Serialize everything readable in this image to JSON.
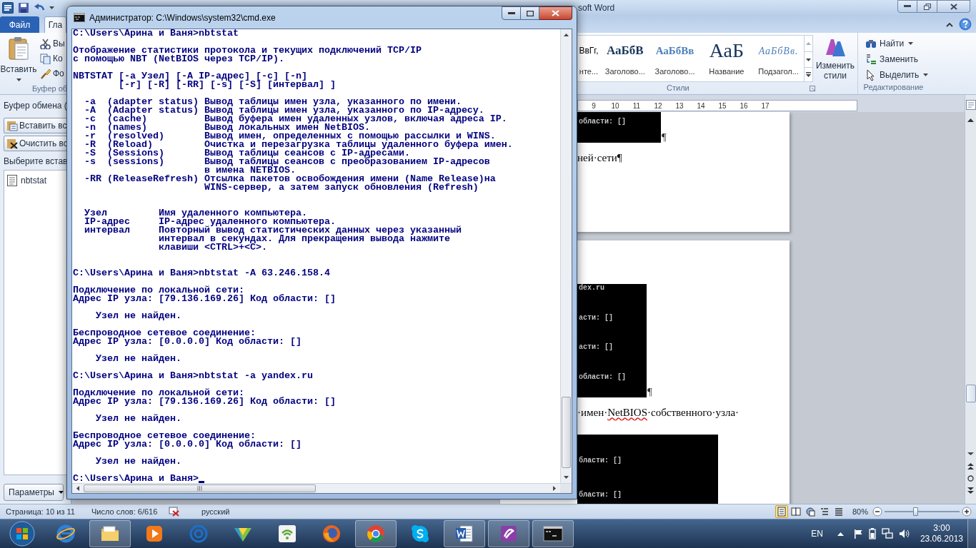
{
  "word": {
    "title": "soft Word",
    "tabs": [
      {
        "label": "Файл",
        "kind": "file",
        "selected": false
      },
      {
        "label": "Гла",
        "kind": "tab",
        "selected": true
      }
    ],
    "clipboard_group": {
      "paste": "Вставить",
      "items": [
        "Вы",
        "Ко",
        "Фо"
      ],
      "label": "Буфер об"
    },
    "styles_group": {
      "styles": [
        {
          "kind": "normal",
          "sample": "ВвГг,",
          "name": "нте..."
        },
        {
          "kind": "heading1",
          "sample": "АаБбВ",
          "name": "Заголово..."
        },
        {
          "kind": "heading2",
          "sample": "АаБбВв",
          "name": "Заголово..."
        },
        {
          "kind": "title",
          "sample": "АаБ",
          "name": "Название"
        },
        {
          "kind": "subtitle",
          "sample": "АаБбВв.",
          "name": "Подзагол..."
        }
      ],
      "change_styles": "Изменить стили",
      "label": "Стили"
    },
    "editing_group": {
      "items": [
        {
          "label": "Найти",
          "kind": "find",
          "has_menu": true
        },
        {
          "label": "Заменить",
          "kind": "replace",
          "has_menu": false
        },
        {
          "label": "Выделить",
          "kind": "select",
          "has_menu": true
        }
      ],
      "label": "Редактирование"
    },
    "clipboard_pane": {
      "title": "Буфер обмена (",
      "paste_all": "Вставить вс",
      "clear_all": "Очистить вс",
      "hint": "Выберите встав",
      "items": [
        "nbtstat"
      ],
      "options": "Параметры"
    },
    "ruler": [
      "9",
      "10",
      "11",
      "12",
      "13",
      "14",
      "15",
      "16",
      "17"
    ],
    "pages": [
      {
        "blocks": [
          {
            "kind": "image",
            "lines": [
              "области: []"
            ],
            "end_mark": "¶"
          },
          {
            "kind": "text",
            "segments": [
              {
                "text": "ней·сети¶",
                "misspelled": false
              }
            ]
          }
        ]
      },
      {
        "blocks": [
          {
            "kind": "image",
            "lines": [
              "dex.ru",
              "асти: []",
              "асти: []",
              "области: []"
            ],
            "end_mark": "¶"
          },
          {
            "kind": "text",
            "segments": [
              {
                "text": "·имен·",
                "misspelled": false
              },
              {
                "text": "NetBIOS",
                "misspelled": true
              },
              {
                "text": "·собственного·узла·",
                "misspelled": false
              }
            ]
          },
          {
            "kind": "image",
            "lines": [
              "бласти: []",
              "бласти: []"
            ]
          }
        ]
      }
    ],
    "status_bar": {
      "page": "Страница: 10 из 11",
      "words": "Число слов: 6/616",
      "language": "русский",
      "views": [
        {
          "kind": "print",
          "selected": true
        },
        {
          "kind": "reading",
          "selected": false
        },
        {
          "kind": "web",
          "selected": false
        },
        {
          "kind": "outline",
          "selected": false
        },
        {
          "kind": "draft",
          "selected": false
        }
      ],
      "zoom": "80%",
      "zoom_slider": {
        "level": 0.41
      }
    }
  },
  "console_window": {
    "title": "Администратор: C:\\Windows\\system32\\cmd.exe",
    "cursor": true,
    "sections": [
      {
        "paragraphs": [
          {
            "lines": [
              "C:\\Users\\Арина и Ваня>nbtstat"
            ]
          },
          {
            "lines": [
              "Отображение статистики протокола и текущих подключений TCP/IP",
              "с помощью NBT (NetBIOS через TCP/IP)."
            ]
          },
          {
            "lines": [
              "NBTSTAT [-a Узел] [-A IP-адрес] [-c] [-n]",
              "        [-r] [-R] [-RR] [-s] [-S] [интервал] ]"
            ]
          },
          {
            "lines": [
              "  -a  (adapter status) Вывод таблицы имен узла, указанного по имени.",
              "  -A  (Adapter status) Вывод таблицы имен узла, указанного по IP-адресу.",
              "  -c  (cache)          Вывод буфера имен удаленных узлов, включая адреса IP.",
              "  -n  (names)          Вывод локальных имен NetBIOS.",
              "  -r  (resolved)       Вывод имен, определенных с помощью рассылки и WINS.",
              "  -R  (Reload)         Очистка и перезагрузка таблицы удаленного буфера имен.",
              "  -S  (Sessions)       Вывод таблицы сеансов с IP-адресами.",
              "  -s  (sessions)       Вывод таблицы сеансов с преобразованием IP-адресов",
              "                       в имена NETBIOS.",
              "  -RR (ReleaseRefresh) Отсылка пакетов освобождения имени (Name Release)на",
              "                       WINS-сервер, а затем запуск обновления (Refresh)"
            ]
          }
        ]
      },
      {
        "paragraphs": [
          {
            "lines": [
              "  Узел         Имя удаленного компьютера.",
              "  IP-адрес     IP-адрес удаленного компьютера.",
              "  интервал     Повторный вывод статистических данных через указанный",
              "               интервал в секундах. Для прекращения вывода нажмите",
              "               клавиши <CTRL>+<C>."
            ]
          }
        ]
      },
      {
        "paragraphs": [
          {
            "lines": [
              "C:\\Users\\Арина и Ваня>nbtstat -A 63.246.158.4"
            ]
          },
          {
            "lines": [
              "Подключение по локальной сети:",
              "Адрес IP узла: [79.136.169.26] Код области: []"
            ]
          },
          {
            "lines": [
              "    Узел не найден."
            ]
          },
          {
            "lines": [
              "Беспроводное сетевое соединение:",
              "Адрес IP узла: [0.0.0.0] Код области: []"
            ]
          },
          {
            "lines": [
              "    Узел не найден."
            ]
          },
          {
            "lines": [
              "C:\\Users\\Арина и Ваня>nbtstat -a yandex.ru"
            ]
          },
          {
            "lines": [
              "Подключение по локальной сети:",
              "Адрес IP узла: [79.136.169.26] Код области: []"
            ]
          },
          {
            "lines": [
              "    Узел не найден."
            ]
          },
          {
            "lines": [
              "Беспроводное сетевое соединение:",
              "Адрес IP узла: [0.0.0.0] Код области: []"
            ]
          },
          {
            "lines": [
              "    Узел не найден."
            ]
          },
          {
            "lines": [
              "C:\\Users\\Арина и Ваня>"
            ]
          }
        ]
      }
    ]
  },
  "taskbar": {
    "apps": [
      {
        "kind": "ie",
        "running": false
      },
      {
        "kind": "explorer",
        "running": true
      },
      {
        "kind": "media",
        "running": false
      },
      {
        "kind": "at",
        "running": false
      },
      {
        "kind": "gem",
        "running": false
      },
      {
        "kind": "wifi",
        "running": false
      },
      {
        "kind": "firefox",
        "running": false
      },
      {
        "kind": "chrome",
        "running": true
      },
      {
        "kind": "skype",
        "running": false
      },
      {
        "kind": "word",
        "running": true
      },
      {
        "kind": "notes",
        "running": true
      },
      {
        "kind": "console",
        "running": true
      }
    ],
    "language": "EN",
    "time": "3:00",
    "date": "23.06.2013"
  }
}
